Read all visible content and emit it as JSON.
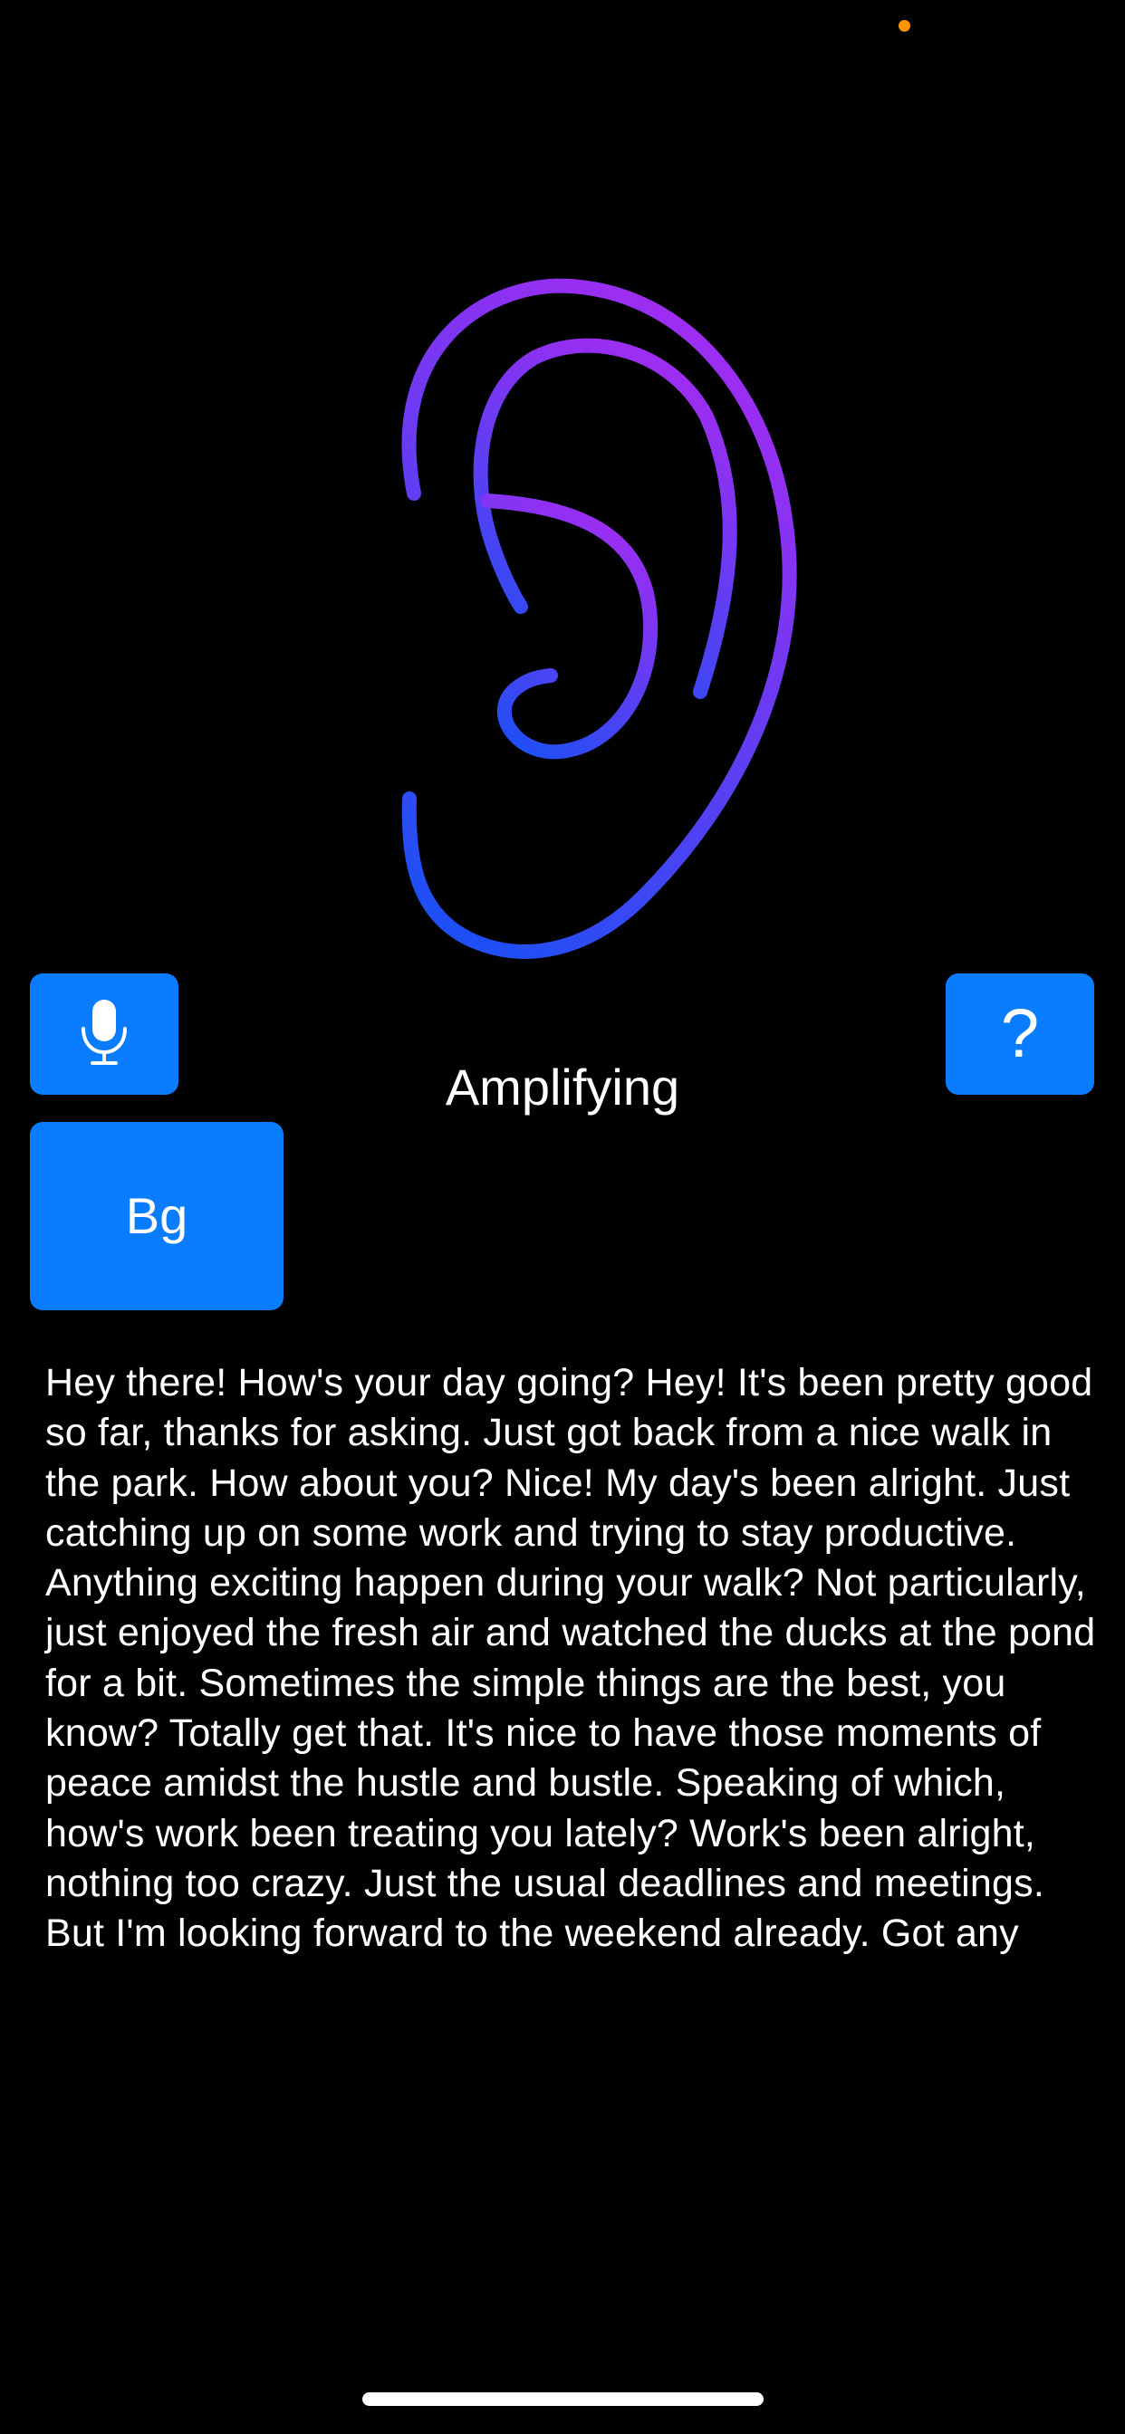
{
  "colors": {
    "background": "#000000",
    "accent_button": "#0a7cff",
    "ear_gradient_top": "#a12cf2",
    "ear_gradient_bottom": "#1f4ff5",
    "privacy_dot": "#ff9500"
  },
  "icons": {
    "ear": "ear-icon",
    "microphone": "microphone-icon"
  },
  "controls": {
    "help_label": "?",
    "background_label": "Bg"
  },
  "status": {
    "text": "Amplifying"
  },
  "transcript": {
    "text": "Hey there! How's your day going? Hey! It's been pretty good so far, thanks for asking. Just got back from a nice walk in the park. How about you? Nice! My day's been alright. Just catching up on some work and trying to stay productive. Anything exciting happen during your walk? Not particularly, just enjoyed the fresh air and watched the ducks at the pond for a bit. Sometimes the simple things are the best, you know? Totally get that. It's nice to have those moments of peace amidst the hustle and bustle. Speaking of which, how's work been treating you lately? Work's been alright, nothing too crazy. Just the usual deadlines and meetings. But I'm looking forward to the weekend already. Got any"
  }
}
